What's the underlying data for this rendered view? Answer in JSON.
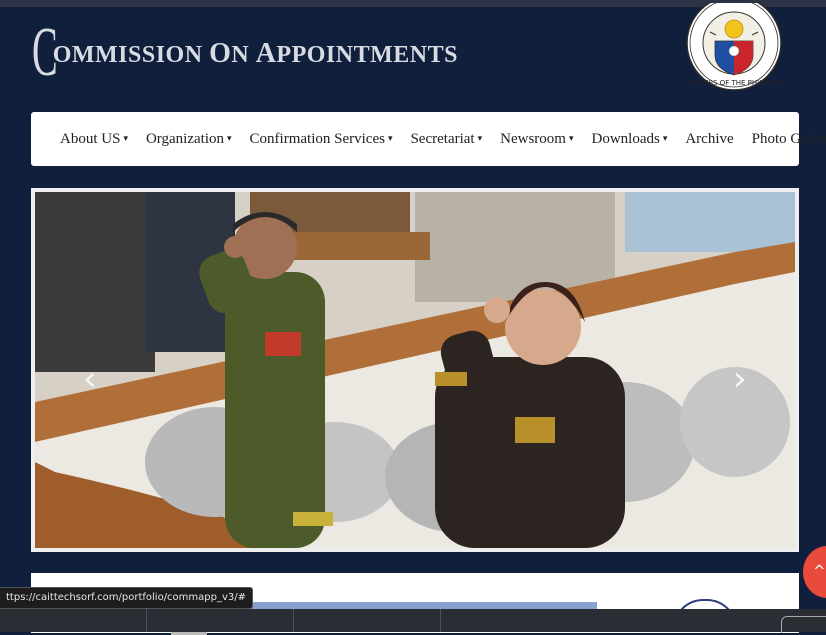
{
  "site": {
    "title_first_letter": "C",
    "title_rest": "OMMISSION ",
    "title_o": "O",
    "title_n": "N ",
    "title_a": "A",
    "title_ppointments": "PPOINTMENTS",
    "seal_text": "CONGRESS OF THE PHILIPPINES"
  },
  "nav": {
    "items": [
      {
        "label": "About US",
        "dropdown": true
      },
      {
        "label": "Organization",
        "dropdown": true
      },
      {
        "label": "Confirmation Services",
        "dropdown": true
      },
      {
        "label": "Secretariat",
        "dropdown": true
      },
      {
        "label": "Newsroom",
        "dropdown": true
      },
      {
        "label": "Downloads",
        "dropdown": true
      },
      {
        "label": "Archive",
        "dropdown": false
      },
      {
        "label": "Photo Gallery",
        "dropdown": false
      }
    ],
    "caret": "▾"
  },
  "slider": {
    "prev_icon": "‹",
    "next_icon": "›"
  },
  "status_bar": {
    "url": "ttps://caittechsorf.com/portfolio/commapp_v3/#"
  },
  "scroll_top": {
    "icon": "^"
  },
  "colors": {
    "page_bg": "#0f1f3c",
    "scroll_top_bg": "#e84a3c"
  }
}
